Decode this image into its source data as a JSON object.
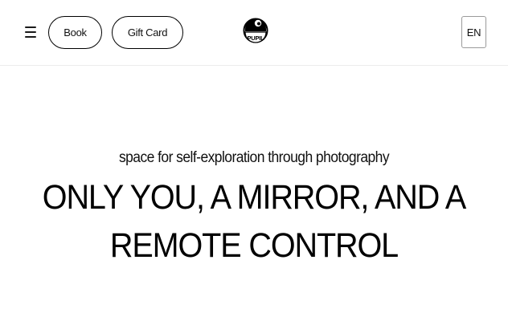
{
  "header": {
    "menu_icon": "hamburger-icon",
    "book_label": "Book",
    "gift_card_label": "Gift Card",
    "logo_text": "PUPIL",
    "language_label": "EN"
  },
  "hero": {
    "subtitle": "space for self-exploration through photography",
    "headline_line1": "ONLY YOU, A MIRROR, AND A",
    "headline_line2": "REMOTE CONTROL"
  }
}
